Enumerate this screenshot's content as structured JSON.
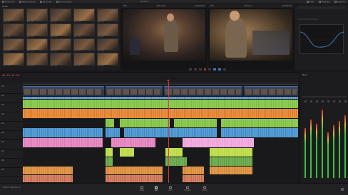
{
  "app": {
    "name": "DaVinci Resolve 14"
  },
  "top_bar": {
    "items": [
      "Media Pool",
      "Effects Library",
      "Edit Index",
      "Sound Library",
      "Timeline",
      "Mixer",
      "Metadata",
      "Inspector"
    ]
  },
  "media_pool": {
    "bin": "Master",
    "clips": [
      "A001_C003",
      "A001_C005",
      "A001_C007",
      "A001_C009",
      "A002_C001",
      "A002_C004",
      "A002_C006",
      "A002_C008",
      "A003_C002",
      "A003_C003",
      "A003_C005",
      "A003_C007",
      "B001_C001",
      "B001_C002",
      "B001_C004",
      "B001_C006",
      "B002_C003",
      "B002_C005",
      "B002_C007",
      "B002_C009"
    ]
  },
  "source_viewer": {
    "zoom": "39%",
    "timecode": "00:00:12:09",
    "clip": "A002_C004"
  },
  "timeline_viewer": {
    "zoom": "38%",
    "name": "Timeline 1",
    "timecode": "00:29:43:20"
  },
  "timeline": {
    "timecode": "00:29:43:20",
    "tracks": [
      {
        "id": "V1",
        "label": "Video 1"
      },
      {
        "id": "A1",
        "label": "Audio 1"
      },
      {
        "id": "A2",
        "label": "Audio 2"
      },
      {
        "id": "A3",
        "label": "Audio 3"
      },
      {
        "id": "A4",
        "label": "Audio 4"
      },
      {
        "id": "A5",
        "label": "Audio 5"
      },
      {
        "id": "A6",
        "label": "Audio 6"
      },
      {
        "id": "A7",
        "label": "Audio 7"
      },
      {
        "id": "A8",
        "label": "Audio 8"
      },
      {
        "id": "A9",
        "label": "Audio 9"
      }
    ]
  },
  "mixer": {
    "title": "Mixer",
    "channels": [
      "A1",
      "A2",
      "A3",
      "A4",
      "A5",
      "A6",
      "A7",
      "M1"
    ]
  },
  "pages": [
    {
      "label": "Media",
      "active": false
    },
    {
      "label": "Edit",
      "active": true
    },
    {
      "label": "Color",
      "active": false
    },
    {
      "label": "Fairlight",
      "active": false
    },
    {
      "label": "Deliver",
      "active": false
    }
  ],
  "colors": {
    "orange": "#e07a22",
    "green": "#7abf3a",
    "blue": "#3a8ac8",
    "pink": "#e07ab8",
    "lime": "#b8d83a",
    "playhead": "#d83a3a"
  }
}
